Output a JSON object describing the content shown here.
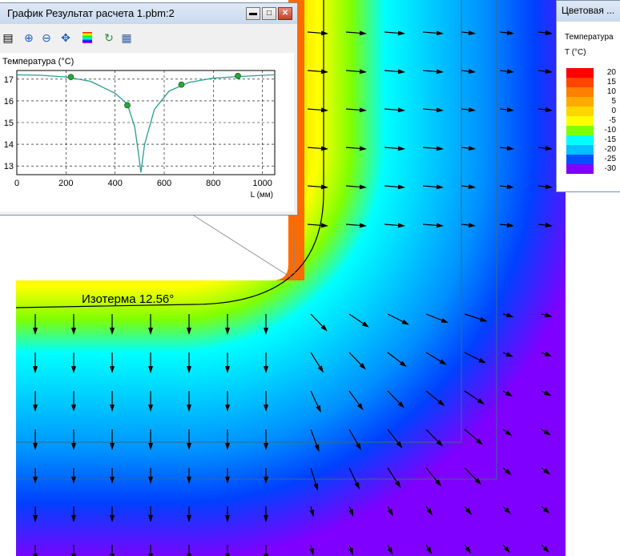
{
  "graph_window": {
    "title": "График Результат расчета 1.pbm:2",
    "buttons": {
      "minimize": "▬",
      "maximize": "□",
      "close": "✕"
    },
    "toolbar": [
      "sheet-icon",
      "zoom-in-icon",
      "zoom-out-icon",
      "fit-icon",
      "palette-icon",
      "refresh-icon",
      "table-icon"
    ]
  },
  "legend_window": {
    "title": "Цветовая ...",
    "quantity": "Температура",
    "unit": "T (°C)",
    "levels": [
      {
        "value": "20",
        "color": "#ff0000"
      },
      {
        "value": "15",
        "color": "#ff4500"
      },
      {
        "value": "10",
        "color": "#ff8000"
      },
      {
        "value": "5",
        "color": "#ffaa00"
      },
      {
        "value": "0",
        "color": "#ffd700"
      },
      {
        "value": "-5",
        "color": "#ffff00"
      },
      {
        "value": "-10",
        "color": "#7fff00"
      },
      {
        "value": "-15",
        "color": "#00ffff"
      },
      {
        "value": "-20",
        "color": "#00c0ff"
      },
      {
        "value": "-25",
        "color": "#0050ff"
      },
      {
        "value": "-30",
        "color": "#8000ff"
      }
    ]
  },
  "isotherm_label": "Изотерма 12.56°",
  "chart_data": {
    "type": "line",
    "ylabel": "Температура (°C)",
    "xlabel": "L (мм)",
    "xlim": [
      0,
      1050
    ],
    "ylim": [
      12.6,
      17.4
    ],
    "xticks": [
      0,
      200,
      400,
      600,
      800,
      1000
    ],
    "yticks": [
      13,
      14,
      15,
      16,
      17
    ],
    "grid": true,
    "x": [
      0,
      100,
      200,
      300,
      400,
      450,
      480,
      495,
      505,
      520,
      560,
      620,
      700,
      800,
      900,
      1000,
      1050
    ],
    "y": [
      17.2,
      17.18,
      17.1,
      16.9,
      16.35,
      15.85,
      14.8,
      13.6,
      12.7,
      14.0,
      15.6,
      16.45,
      16.85,
      17.05,
      17.12,
      17.18,
      17.2
    ],
    "markers": [
      {
        "x": 220,
        "y": 17.1
      },
      {
        "x": 450,
        "y": 15.8
      },
      {
        "x": 670,
        "y": 16.75
      },
      {
        "x": 900,
        "y": 17.15
      }
    ],
    "line_color": "#2a9d8f",
    "marker_color": "#2aa33b"
  }
}
